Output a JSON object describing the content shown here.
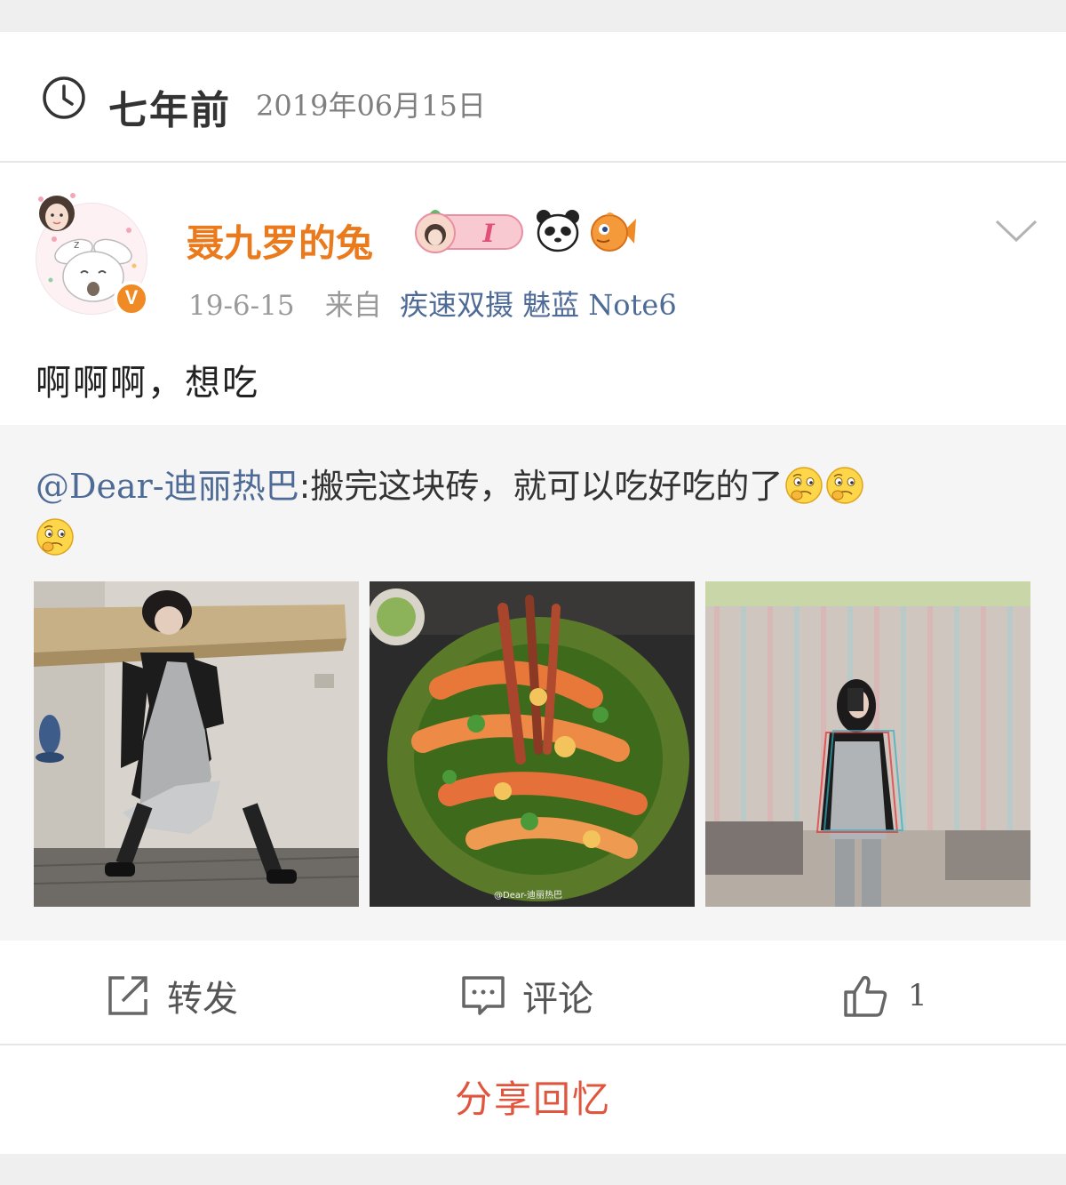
{
  "memory": {
    "title": "七年前",
    "date": "2019年06月15日"
  },
  "post": {
    "username": "聂九罗的兔",
    "member_level": "I",
    "time": "19-6-15",
    "from_label": "来自",
    "source": "疾速双摄 魅蓝",
    "source_model": "Note6",
    "text": "啊啊啊，想吃",
    "verified_mark": "V"
  },
  "retweet": {
    "mention": "@Dear-迪丽热巴",
    "text": ":搬完这块砖，就可以吃好吃的了",
    "photo_watermark": "@Dear-迪丽热巴"
  },
  "actions": {
    "repost_label": "转发",
    "comment_label": "评论",
    "like_count": "1"
  },
  "share_label": "分享回忆",
  "icons": {
    "clock": "clock-icon",
    "repost": "share-out-icon",
    "comment": "comment-bubble-icon",
    "like": "thumbs-up-icon",
    "expand": "chevron-down-icon",
    "emoji": "thinking-face-emoji"
  },
  "colors": {
    "username": "#eb7a1c",
    "link": "#4e6a96",
    "share": "#e0553d",
    "verified": "#f08a24"
  }
}
